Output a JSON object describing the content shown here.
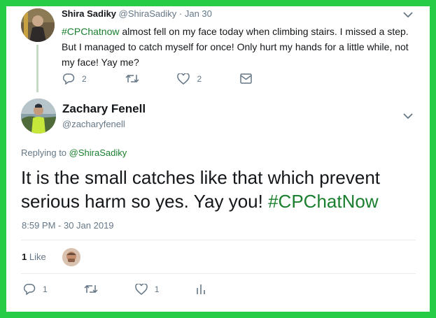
{
  "parent_tweet": {
    "name": "Shira Sadiky",
    "handle": "@ShiraSadiky",
    "separator": "·",
    "date": "Jan 30",
    "hashtag": "#CPChatnow",
    "text_rest": " almost fell on my face today when climbing stairs. I missed a step. But I managed to catch myself for once! Only hurt my hands for a little while, not my face! Yay me?",
    "replies": "2",
    "likes": "2"
  },
  "reply_tweet": {
    "name": "Zachary Fenell",
    "handle": "@zacharyfenell",
    "replying_prefix": "Replying to",
    "replying_handle": "@ShiraSadiky",
    "text_main": "It is the small catches like that which prevent serious harm so yes. Yay you! ",
    "hashtag": "#CPChatNow",
    "timestamp": "8:59 PM - 30 Jan 2019",
    "like_count": "1",
    "like_label": "Like",
    "replies": "1",
    "likes": "1"
  },
  "icons": {
    "reply": "reply-icon",
    "retweet": "retweet-icon",
    "like": "heart-icon",
    "dm": "envelope-icon",
    "analytics": "analytics-icon",
    "caret": "chevron-down-icon"
  },
  "colors": {
    "frame": "#27cc46",
    "hashtag": "#1a7f2e",
    "muted": "#657786"
  }
}
